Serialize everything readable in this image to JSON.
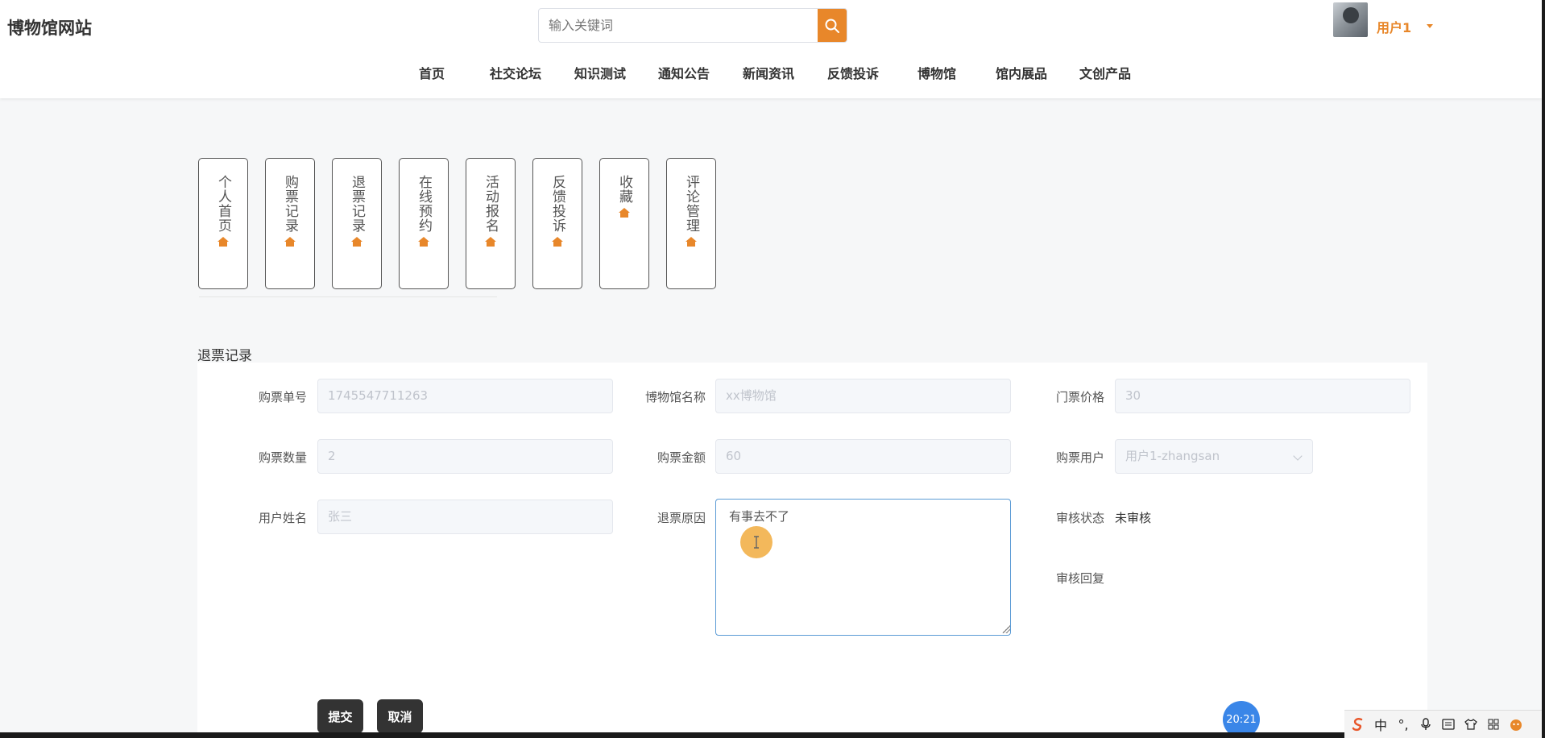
{
  "header": {
    "site_title": "博物馆网站",
    "search_placeholder": "输入关键词",
    "user_name": "用户1"
  },
  "nav": [
    {
      "label": "首页"
    },
    {
      "label": "社交论坛"
    },
    {
      "label": "知识测试"
    },
    {
      "label": "通知公告"
    },
    {
      "label": "新闻资讯"
    },
    {
      "label": "反馈投诉"
    },
    {
      "label": "博物馆"
    },
    {
      "label": "馆内展品"
    },
    {
      "label": "文创产品"
    }
  ],
  "side_menu": [
    {
      "label": "个人首页"
    },
    {
      "label": "购票记录"
    },
    {
      "label": "退票记录"
    },
    {
      "label": "在线预约"
    },
    {
      "label": "活动报名"
    },
    {
      "label": "反馈投诉"
    },
    {
      "label": "收藏"
    },
    {
      "label": "评论管理"
    }
  ],
  "section_title": "退票记录",
  "form": {
    "order_no_label": "购票单号",
    "order_no_value": "1745547711263",
    "museum_label": "博物馆名称",
    "museum_value": "xx博物馆",
    "price_label": "门票价格",
    "price_value": "30",
    "quantity_label": "购票数量",
    "quantity_value": "2",
    "amount_label": "购票金额",
    "amount_value": "60",
    "buyer_label": "购票用户",
    "buyer_value": "用户1-zhangsan",
    "username_label": "用户姓名",
    "username_value": "张三",
    "reason_label": "退票原因",
    "reason_value": "有事去不了",
    "status_label": "审核状态",
    "status_value": "未审核",
    "reply_label": "审核回复",
    "submit_label": "提交",
    "cancel_label": "取消"
  },
  "clock": "20:21",
  "tray": {
    "ime": "中",
    "ime_mode": "°,"
  },
  "colors": {
    "accent": "#e8872a",
    "button": "#333333",
    "focus_border": "#5b9bd5"
  }
}
